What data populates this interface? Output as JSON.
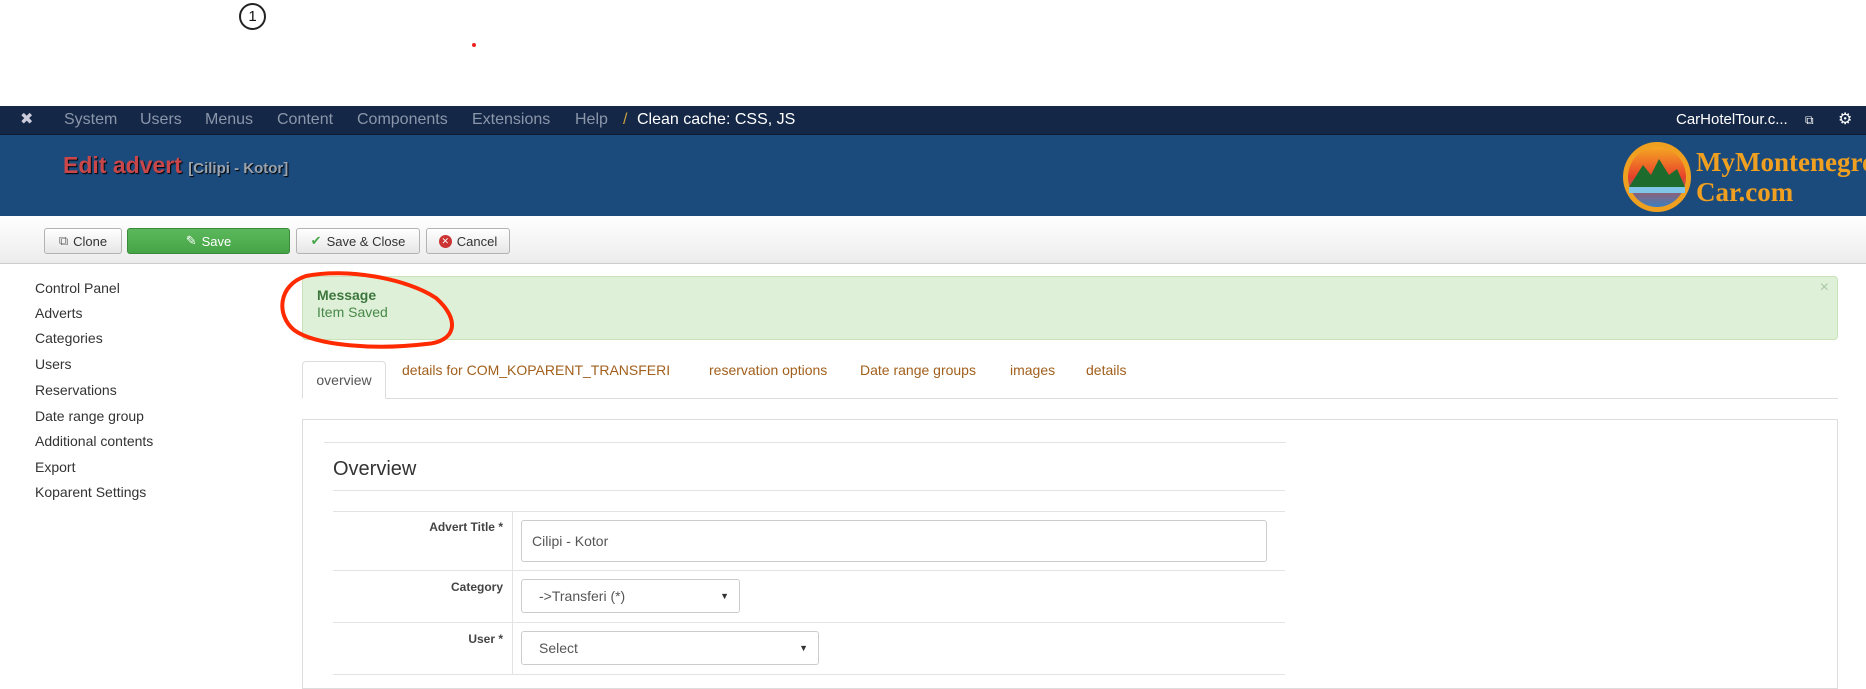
{
  "annotation": {
    "step_number": "1"
  },
  "navbar": {
    "items": [
      "System",
      "Users",
      "Menus",
      "Content",
      "Components",
      "Extensions",
      "Help"
    ],
    "clean_cache": "Clean cache: CSS, JS",
    "site_link": "CarHotelTour.c..."
  },
  "header": {
    "title": "Edit advert",
    "subtitle": "[Cilipi - Kotor]",
    "logo_text_1": "MyMontenegro",
    "logo_text_2": "Car.com"
  },
  "toolbar": {
    "clone": "Clone",
    "save": "Save",
    "save_close": "Save & Close",
    "cancel": "Cancel"
  },
  "sidebar": {
    "items": [
      "Control Panel",
      "Adverts",
      "Categories",
      "Users",
      "Reservations",
      "Date range group",
      "Additional contents",
      "Export",
      "Koparent Settings"
    ]
  },
  "message": {
    "heading": "Message",
    "text": "Item Saved",
    "close": "×"
  },
  "tabs": [
    "overview",
    "details for COM_KOPARENT_TRANSFERI",
    "reservation options",
    "Date range groups",
    "images",
    "details"
  ],
  "form": {
    "section_title": "Overview",
    "advert_title_label": "Advert Title *",
    "advert_title_value": "Cilipi - Kotor",
    "category_label": "Category",
    "category_value": "->Transferi (*)",
    "user_label": "User *",
    "user_value": "Select"
  },
  "colors": {
    "navbar": "#152747",
    "header": "#1b4a7c",
    "save_button": "#46a546",
    "message_bg": "#dff0d8",
    "tab_link": "#a25f1c",
    "annotation_ellipse": "#ff2a00"
  }
}
